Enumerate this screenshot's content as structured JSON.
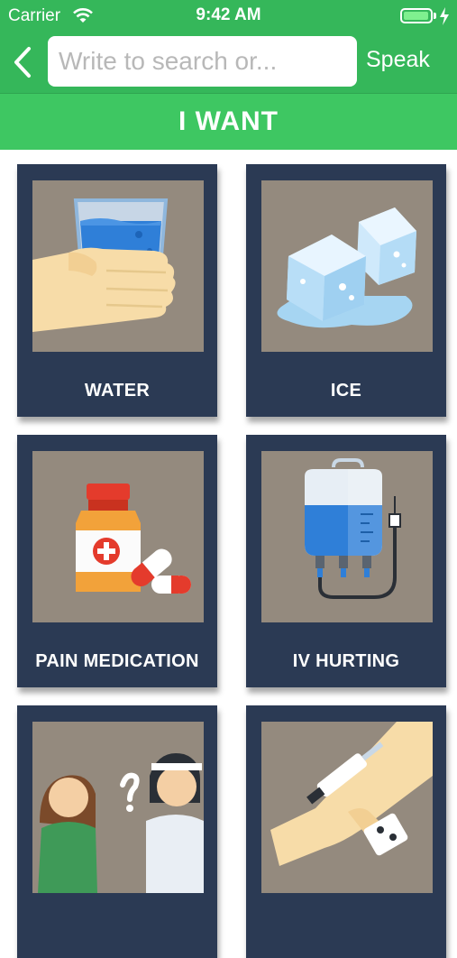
{
  "status_bar": {
    "carrier": "Carrier",
    "time": "9:42 AM",
    "battery_level": 0.95
  },
  "nav": {
    "search_placeholder": "Write to search or...",
    "speak_label": "Speak"
  },
  "category_title": "I WANT",
  "tiles": [
    {
      "label": "WATER",
      "icon": "water-glass-icon"
    },
    {
      "label": "ICE",
      "icon": "ice-cubes-icon"
    },
    {
      "label": "PAIN MEDICATION",
      "icon": "medicine-bottle-icon"
    },
    {
      "label": "IV HURTING",
      "icon": "iv-bag-icon"
    },
    {
      "label": "",
      "icon": "confused-doctor-icon"
    },
    {
      "label": "",
      "icon": "arm-injection-icon"
    }
  ],
  "colors": {
    "header_green": "#35b75a",
    "title_green": "#3ec762",
    "tile_navy": "#2b3a54",
    "image_bg": "#948a7e"
  }
}
